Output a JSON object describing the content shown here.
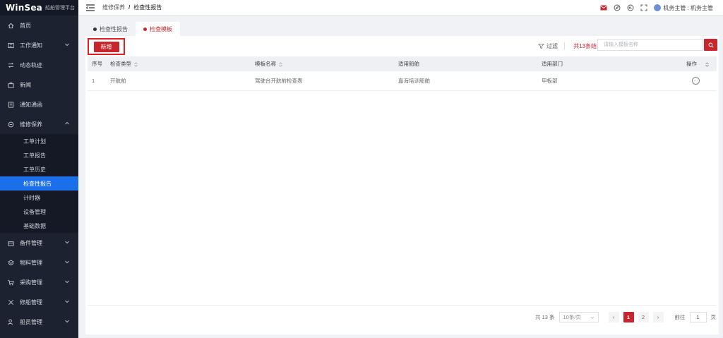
{
  "brand": {
    "name": "WinSea",
    "subtitle": "船舶管理平台"
  },
  "sidebar": {
    "items": [
      {
        "label": "首页",
        "icon": "home-icon"
      },
      {
        "label": "工作通知",
        "icon": "notice-icon",
        "has_children": true
      },
      {
        "label": "动态轨迹",
        "icon": "track-icon"
      },
      {
        "label": "新闻",
        "icon": "news-icon"
      },
      {
        "label": "通知通函",
        "icon": "circular-icon"
      },
      {
        "label": "维修保养",
        "icon": "maintenance-icon",
        "expanded": true
      }
    ],
    "sub_items": [
      {
        "label": "工单计划"
      },
      {
        "label": "工单报告"
      },
      {
        "label": "工单历史"
      },
      {
        "label": "检查性报告",
        "active": true
      },
      {
        "label": "计时器"
      },
      {
        "label": "设备管理"
      },
      {
        "label": "基础数据"
      }
    ],
    "items_after": [
      {
        "label": "备件管理",
        "icon": "spare-parts-icon"
      },
      {
        "label": "物料管理",
        "icon": "materials-icon"
      },
      {
        "label": "采购管理",
        "icon": "cart-icon"
      },
      {
        "label": "修船管理",
        "icon": "repair-icon"
      },
      {
        "label": "船员管理",
        "icon": "crew-icon"
      }
    ]
  },
  "breadcrumb": {
    "parent": "维修保养",
    "separator": "/",
    "current": "检查性报告"
  },
  "user": {
    "name": "机务主管 : 机务主管"
  },
  "tabs": [
    {
      "label": "检查性报告",
      "active": false
    },
    {
      "label": "检查模板",
      "active": true
    }
  ],
  "toolbar": {
    "add_label": "新增",
    "filter_label": "过滤",
    "result_count": "共13条结果",
    "search_placeholder": "请输入模板名称"
  },
  "table": {
    "headers": [
      "序号",
      "检查类型",
      "模板名称",
      "适用船舶",
      "适用部门",
      "操作"
    ],
    "rows": [
      {
        "index": "1",
        "type": "开航前",
        "template": "驾驶台开航前检查表",
        "ship": "嘉海培训船舶",
        "dept": "甲板部",
        "op": "···"
      }
    ]
  },
  "pagination": {
    "total": "共 13 条",
    "page_size": "10条/页",
    "prev": "‹",
    "next": "›",
    "pages": [
      "1",
      "2"
    ],
    "current": "1",
    "goto_label": "前往",
    "goto_value": "1",
    "page_suffix": "页"
  },
  "colors": {
    "accent": "#c9252c",
    "sidebar_bg": "#1d2230",
    "active_blue": "#1b6fe8",
    "highlight_box": "#e02020"
  }
}
